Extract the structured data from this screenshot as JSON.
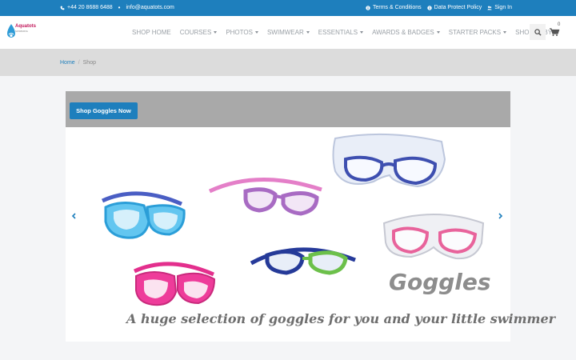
{
  "topbar": {
    "phone": "+44 20 8688 6488",
    "email": "info@aquatots.com",
    "terms": "Terms & Conditions",
    "privacy": "Data Protect Policy",
    "signin": "Sign In"
  },
  "brand": {
    "name": "Aquatots",
    "tagline": "SWIMMING"
  },
  "nav": {
    "items": [
      {
        "label": "SHOP HOME",
        "dropdown": false
      },
      {
        "label": "COURSES",
        "dropdown": true
      },
      {
        "label": "PHOTOS",
        "dropdown": true
      },
      {
        "label": "SWIMWEAR",
        "dropdown": true
      },
      {
        "label": "ESSENTIALS",
        "dropdown": true
      },
      {
        "label": "AWARDS & BADGES",
        "dropdown": true
      },
      {
        "label": "STARTER PACKS",
        "dropdown": true
      },
      {
        "label": "SHOP BABY",
        "dropdown": true
      }
    ],
    "cart_count": "0"
  },
  "breadcrumb": {
    "home": "Home",
    "separator": "/",
    "current": "Shop"
  },
  "slider": {
    "button_label": "Shop Goggles Now",
    "title": "Goggles",
    "tagline": "A huge selection of goggles for you and your little swimmer"
  },
  "colors": {
    "brand_blue": "#1e7fbd",
    "banner_gray": "#a9a9a9",
    "breadcrumb_band": "#dcdcdc"
  },
  "icons": [
    "phone-icon",
    "email-icon",
    "info-icon",
    "user-icon",
    "search-icon",
    "cart-icon",
    "chevron-left-icon",
    "chevron-right-icon"
  ]
}
